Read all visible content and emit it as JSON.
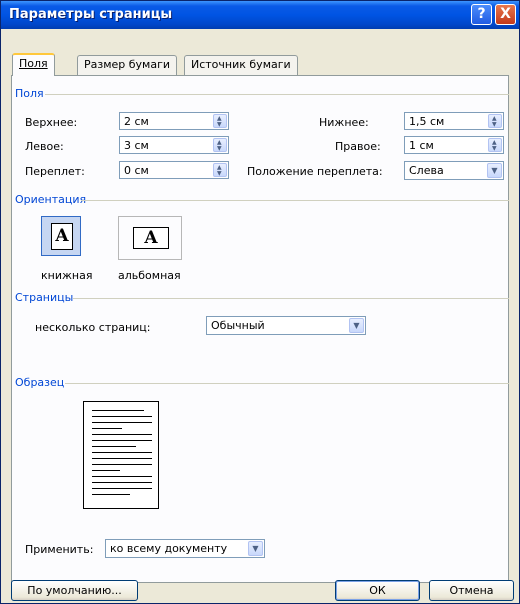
{
  "window": {
    "title": "Параметры страницы"
  },
  "titlebar_buttons": {
    "help": "?",
    "close": "X"
  },
  "tabs": [
    {
      "label": "Поля",
      "active": true
    },
    {
      "label": "Размер бумаги",
      "active": false
    },
    {
      "label": "Источник бумаги",
      "active": false
    }
  ],
  "margins": {
    "group_label": "Поля",
    "top": {
      "label": "Верхнее:",
      "value": "2 см"
    },
    "left": {
      "label": "Левое:",
      "value": "3 см"
    },
    "gutter": {
      "label": "Переплет:",
      "value": "0 см"
    },
    "bottom": {
      "label": "Нижнее:",
      "value": "1,5 см"
    },
    "right": {
      "label": "Правое:",
      "value": "1 см"
    },
    "gutter_pos": {
      "label": "Положение переплета:",
      "value": "Слева"
    }
  },
  "orientation": {
    "group_label": "Ориентация",
    "portrait": {
      "label": "книжная",
      "glyph": "A",
      "selected": true
    },
    "landscape": {
      "label": "альбомная",
      "glyph": "A",
      "selected": false
    }
  },
  "pages": {
    "group_label": "Страницы",
    "multiple_label": "несколько страниц:",
    "multiple_value": "Обычный"
  },
  "preview": {
    "group_label": "Образец",
    "apply_label": "Применить:",
    "apply_value": "ко всему документу"
  },
  "footer": {
    "default_button": "По умолчанию...",
    "ok_button": "ОК",
    "cancel_button": "Отмена"
  },
  "icons": {
    "spin": "spin-arrows-icon",
    "dropdown": "chevron-down-icon"
  },
  "colors": {
    "titlebar": "#0054e3",
    "group_label": "#0046d5",
    "selected_orientation": "#c6d6f2"
  }
}
